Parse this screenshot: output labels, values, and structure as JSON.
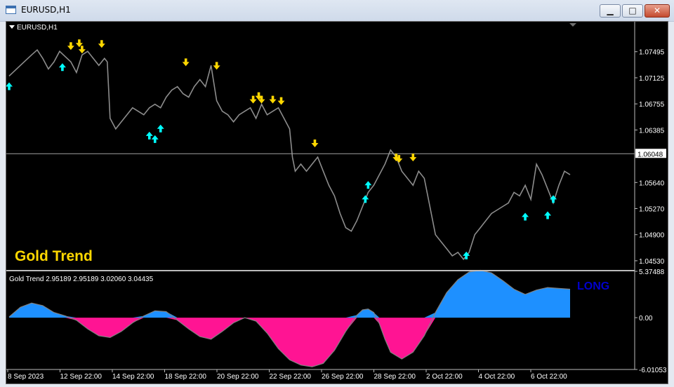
{
  "window": {
    "title": "EURUSD,H1",
    "minimize_glyph": "▁",
    "maximize_glyph": "□",
    "close_glyph": "✕"
  },
  "main_chart": {
    "symbol_label": "EURUSD,H1",
    "overlay_label": "Gold Trend",
    "current_price": "1.06048"
  },
  "indicator": {
    "header": "Gold Trend  2.95189 2.95189 3.02060 3.04435",
    "signal": "LONG"
  },
  "colors": {
    "background": "#000000",
    "candles": "#8c8c8c",
    "buy_arrow": "#00ffff",
    "sell_arrow": "#ffd700",
    "overlay_label": "#ffd700",
    "histogram_positive": "#1e90ff",
    "histogram_negative": "#ff1493",
    "signal_text": "#0000cd",
    "price_line": "#a0a0a0"
  },
  "chart_data": [
    {
      "type": "line",
      "title": "EURUSD,H1",
      "ylim": [
        1.044,
        1.079
      ],
      "y_ticks": [
        "1.07495",
        "1.07125",
        "1.06755",
        "1.06385",
        "1.05640",
        "1.05270",
        "1.04900",
        "1.04530"
      ],
      "x_ticks": [
        "8 Sep 2023",
        "12 Sep 22:00",
        "14 Sep 22:00",
        "18 Sep 22:00",
        "20 Sep 22:00",
        "22 Sep 22:00",
        "26 Sep 22:00",
        "28 Sep 22:00",
        "2 Oct 22:00",
        "4 Oct 22:00",
        "6 Oct 22:00"
      ],
      "x_range": [
        0,
        100
      ],
      "series": [
        {
          "x": [
            0,
            2,
            4,
            5,
            6,
            7,
            8,
            9,
            11,
            12,
            13,
            14,
            15,
            16,
            17,
            17.5,
            18,
            19,
            20,
            21,
            22,
            23,
            24,
            25,
            26,
            27,
            28,
            29,
            30,
            31,
            32,
            33,
            34,
            35,
            36,
            37,
            38,
            39,
            40,
            41,
            42,
            43,
            44,
            45,
            46,
            47,
            48,
            49,
            50,
            50.5,
            51,
            52,
            53,
            54,
            55,
            56,
            57,
            58,
            59,
            60,
            61,
            62,
            63,
            64,
            65,
            66,
            67,
            68,
            69,
            70,
            71,
            72,
            73,
            74,
            75,
            76,
            77,
            78,
            79,
            80,
            81,
            82,
            83,
            84,
            85,
            86,
            87,
            88,
            89,
            90,
            91,
            92,
            93,
            94,
            95,
            96,
            97,
            98,
            99,
            100
          ],
          "values": [
            1.0715,
            1.073,
            1.0745,
            1.0752,
            1.074,
            1.0725,
            1.0735,
            1.075,
            1.0735,
            1.072,
            1.0745,
            1.075,
            1.074,
            1.073,
            1.074,
            1.0735,
            1.0655,
            1.064,
            1.065,
            1.066,
            1.067,
            1.0665,
            1.066,
            1.067,
            1.0675,
            1.067,
            1.0685,
            1.0695,
            1.07,
            1.069,
            1.0685,
            1.07,
            1.071,
            1.07,
            1.073,
            1.068,
            1.0665,
            1.066,
            1.065,
            1.066,
            1.0665,
            1.067,
            1.0655,
            1.0675,
            1.066,
            1.0665,
            1.067,
            1.0655,
            1.064,
            1.06,
            1.058,
            1.059,
            1.058,
            1.059,
            1.06,
            1.058,
            1.056,
            1.0545,
            1.052,
            1.05,
            1.0495,
            1.051,
            1.053,
            1.055,
            1.056,
            1.0575,
            1.059,
            1.061,
            1.06,
            1.058,
            1.057,
            1.056,
            1.058,
            1.057,
            1.053,
            1.049,
            1.048,
            1.047,
            1.046,
            1.0465,
            1.0455,
            1.0465,
            1.049,
            1.05,
            1.051,
            1.052,
            1.0525,
            1.053,
            1.0535,
            1.055,
            1.0545,
            1.056,
            1.054,
            1.059,
            1.0575,
            1.0555,
            1.0535,
            1.056,
            1.058,
            1.0575
          ]
        }
      ],
      "price_line": 1.06048,
      "buy_arrows": [
        [
          0,
          1.071
        ],
        [
          9.5,
          1.0737
        ],
        [
          25,
          1.064
        ],
        [
          26,
          1.0635
        ],
        [
          27,
          1.065
        ],
        [
          63.5,
          1.055
        ],
        [
          64,
          1.057
        ],
        [
          81.5,
          1.047
        ],
        [
          92,
          1.0525
        ],
        [
          96,
          1.0527
        ],
        [
          97,
          1.055
        ]
      ],
      "sell_arrows": [
        [
          11,
          1.0748
        ],
        [
          12.5,
          1.0752
        ],
        [
          13,
          1.0743
        ],
        [
          16.5,
          1.0751
        ],
        [
          31.5,
          1.0725
        ],
        [
          37,
          1.072
        ],
        [
          43.5,
          1.0672
        ],
        [
          44.5,
          1.0677
        ],
        [
          45,
          1.0672
        ],
        [
          47,
          1.0672
        ],
        [
          48.5,
          1.067
        ],
        [
          54.5,
          1.061
        ],
        [
          69,
          1.059
        ],
        [
          69.5,
          1.0588
        ],
        [
          72,
          1.059
        ]
      ]
    },
    {
      "type": "area",
      "title": "Gold Trend",
      "ylim": [
        -6.01053,
        5.37488
      ],
      "y_ticks": [
        "5.37488",
        "0.00",
        "-6.01053"
      ],
      "x_range": [
        0,
        100
      ],
      "series": [
        {
          "x": [
            0,
            2,
            4,
            6,
            8,
            10,
            12,
            14,
            16,
            18,
            20,
            22,
            24,
            26,
            28,
            30,
            32,
            34,
            36,
            38,
            40,
            42,
            44,
            46,
            48,
            50,
            52,
            54,
            56,
            58,
            60,
            62,
            63,
            64,
            65,
            66,
            67,
            68,
            70,
            72,
            74,
            76,
            78,
            80,
            82,
            84,
            86,
            88,
            90,
            92,
            94,
            96,
            98,
            100
          ],
          "values": [
            0.1,
            1.2,
            1.7,
            1.4,
            0.6,
            0.2,
            -0.3,
            -1.3,
            -2.1,
            -2.3,
            -1.6,
            -0.6,
            0.2,
            0.8,
            0.7,
            -0.3,
            -1.3,
            -2.2,
            -2.5,
            -1.6,
            -0.6,
            0.0,
            -0.4,
            -1.8,
            -3.6,
            -4.9,
            -5.5,
            -5.7,
            -5.3,
            -3.8,
            -1.6,
            0.3,
            0.9,
            1.0,
            0.6,
            -0.7,
            -2.5,
            -4.0,
            -4.8,
            -4.0,
            -2.1,
            0.6,
            2.9,
            4.4,
            5.3,
            5.5,
            5.2,
            4.3,
            3.3,
            2.7,
            3.2,
            3.5,
            3.4,
            3.3
          ]
        }
      ]
    }
  ]
}
